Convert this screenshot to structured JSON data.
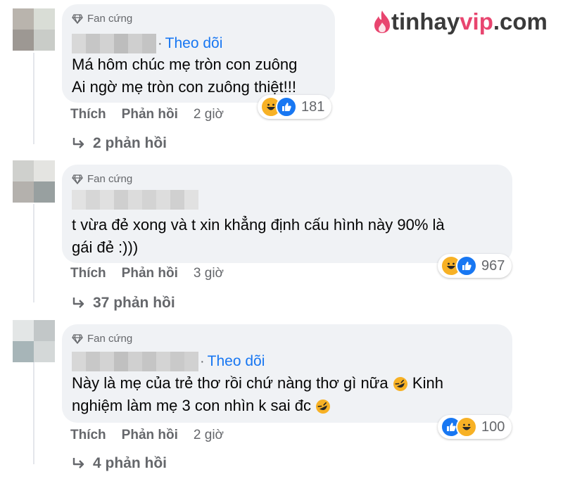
{
  "watermark": {
    "brand": "tinhay",
    "brand_accent": "vip",
    "tld": ".com"
  },
  "colors": {
    "link": "#1877f2",
    "meta": "#65676b",
    "bubble": "#f0f2f5",
    "logo_pink": "#e8456f"
  },
  "comments": [
    {
      "badge": "Fan cứng",
      "follow_sep": "·",
      "follow": "Theo dõi",
      "lines": [
        "Má hôm chúc mẹ tròn con zuông",
        "Ai ngờ mẹ tròn con zuông thiệt!!!"
      ],
      "like": "Thích",
      "reply": "Phản hồi",
      "time": "2 giờ",
      "reaction_count": "181",
      "reaction_icons": [
        "haha-icon",
        "like-icon"
      ],
      "replies_label": "2 phản hồi"
    },
    {
      "badge": "Fan cứng",
      "lines": [
        "t vừa đẻ xong và t xin khẳng định cấu hình này 90% là",
        "gái đẻ :)))"
      ],
      "like": "Thích",
      "reply": "Phản hồi",
      "time": "3 giờ",
      "reaction_count": "967",
      "reaction_icons": [
        "haha-icon",
        "like-icon"
      ],
      "replies_label": "37 phản hồi"
    },
    {
      "badge": "Fan cứng",
      "follow_sep": "·",
      "follow": "Theo dõi",
      "line1_before": "Này là mẹ của trẻ thơ rồi chứ nàng thơ gì nữa",
      "line1_after": "Kinh",
      "line2": "nghiệm làm mẹ 3 con nhìn k sai đc",
      "like": "Thích",
      "reply": "Phản hồi",
      "time": "2 giờ",
      "reaction_count": "100",
      "reaction_icons": [
        "like-icon",
        "haha-icon"
      ],
      "replies_label": "4 phản hồi"
    }
  ]
}
